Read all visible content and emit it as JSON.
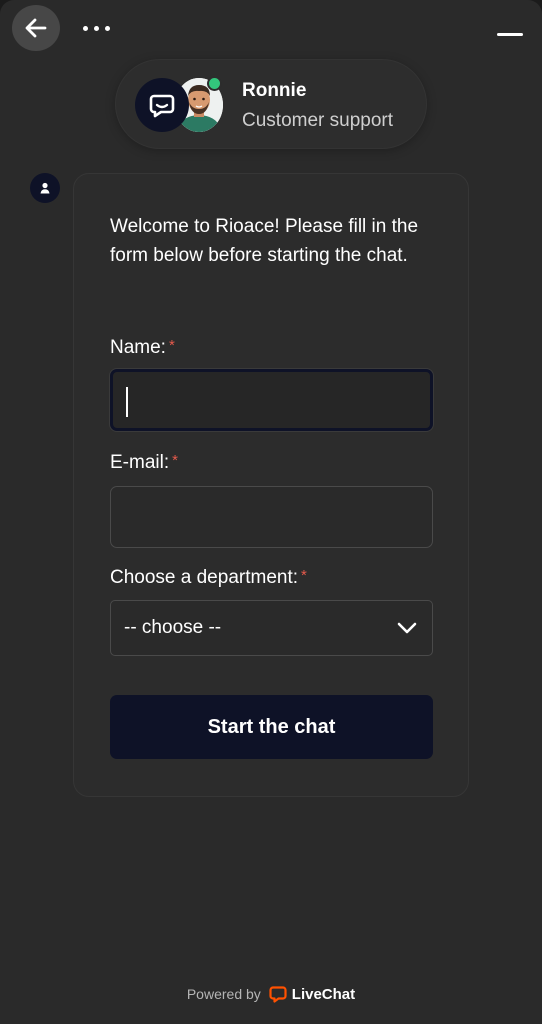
{
  "header": {
    "back_icon": "arrow-left-icon",
    "more_icon": "more-horizontal-icon",
    "minimize_icon": "minimize-icon"
  },
  "agent": {
    "name": "Ronnie",
    "role": "Customer support",
    "status": "online",
    "status_color": "#33c67c"
  },
  "form": {
    "welcome": "Welcome to Rioace! Please fill in the form below before starting the chat.",
    "name_label": "Name:",
    "email_label": "E-mail:",
    "department_label": "Choose a department:",
    "required_mark": "*",
    "name_value": "",
    "email_value": "",
    "department_value": "-- choose --",
    "submit_label": "Start the chat"
  },
  "footer": {
    "powered_by": "Powered by",
    "brand": "LiveChat",
    "brand_color": "#ff5100"
  },
  "colors": {
    "accent": "#0e1227",
    "background": "#2a2a2a",
    "required": "#e65a4c"
  }
}
